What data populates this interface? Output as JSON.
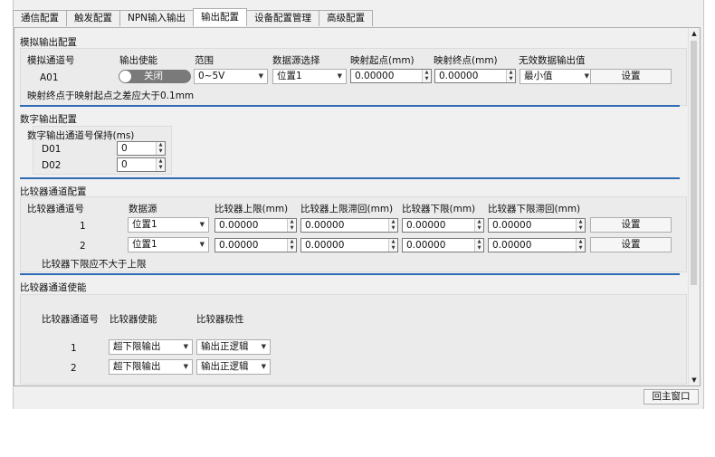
{
  "tabs": [
    "通信配置",
    "触发配置",
    "NPN输入输出",
    "输出配置",
    "设备配置管理",
    "高级配置"
  ],
  "analog": {
    "title": "模拟输出配置",
    "headers": [
      "模拟通道号",
      "输出使能",
      "范围",
      "数据源选择",
      "映射起点(mm)",
      "映射终点(mm)",
      "无效数据输出值"
    ],
    "row": {
      "channel": "A01",
      "toggle_label": "关闭",
      "range": "0~5V",
      "source": "位置1",
      "start": "0.00000",
      "end": "0.00000",
      "invalid": "最小值",
      "button": "设置"
    },
    "note": "映射终点于映射起点之差应大于0.1mm"
  },
  "digital": {
    "title": "数字输出配置",
    "header": "数字输出通道号保持(ms)",
    "rows": [
      {
        "channel": "D01",
        "value": "0"
      },
      {
        "channel": "D02",
        "value": "0"
      }
    ]
  },
  "comparator": {
    "title": "比较器通道配置",
    "headers": [
      "比较器通道号",
      "数据源",
      "比较器上限(mm)",
      "比较器上限滞回(mm)",
      "比较器下限(mm)",
      "比较器下限滞回(mm)"
    ],
    "rows": [
      {
        "channel": "1",
        "source": "位置1",
        "upper": "0.00000",
        "upper_h": "0.00000",
        "lower": "0.00000",
        "lower_h": "0.00000",
        "button": "设置"
      },
      {
        "channel": "2",
        "source": "位置1",
        "upper": "0.00000",
        "upper_h": "0.00000",
        "lower": "0.00000",
        "lower_h": "0.00000",
        "button": "设置"
      }
    ],
    "note": "比较器下限应不大于上限"
  },
  "enable": {
    "title": "比较器通道使能",
    "headers": [
      "比较器通道号",
      "比较器使能",
      "比较器极性"
    ],
    "rows": [
      {
        "channel": "1",
        "enable": "超下限输出",
        "polarity": "输出正逻辑"
      },
      {
        "channel": "2",
        "enable": "超下限输出",
        "polarity": "输出正逻辑"
      }
    ]
  },
  "footer": {
    "back_button": "回主窗口"
  }
}
